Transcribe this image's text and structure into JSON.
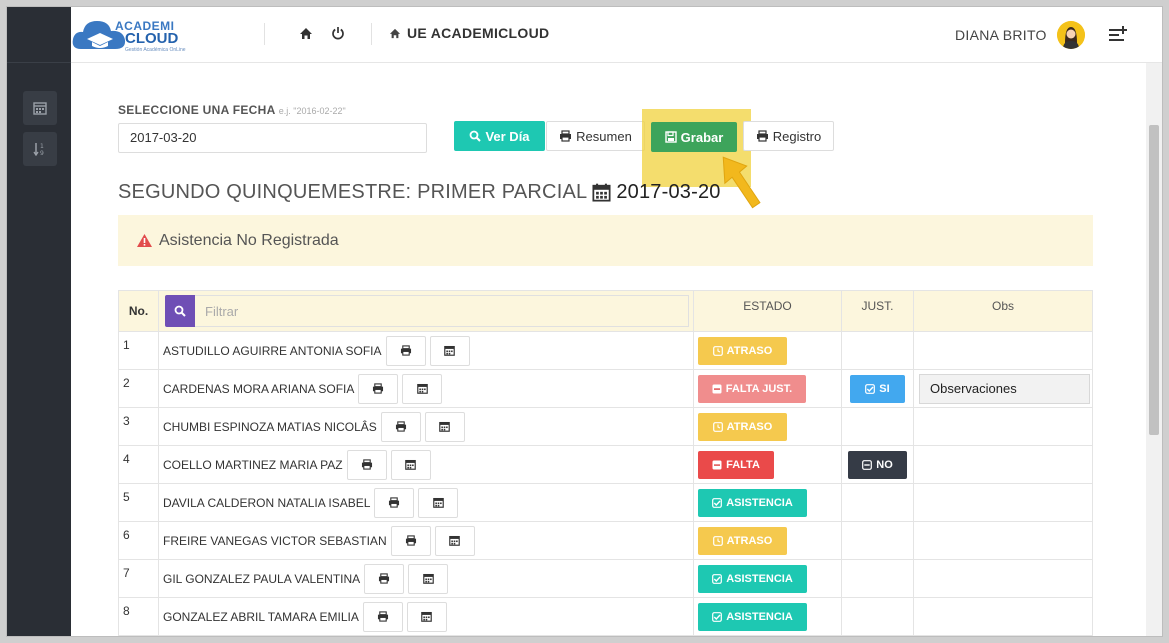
{
  "header": {
    "logo_line1": "ACADEMI",
    "logo_line2": "CLOUD",
    "logo_tagline": "Gestión Académica OnLine",
    "school_name": "UE ACADEMICLOUD",
    "user_name": "DIANA BRITO"
  },
  "date_selector": {
    "label": "SELECCIONE UNA FECHA",
    "hint": "e.j. \"2016-02-22\"",
    "value": "2017-03-20"
  },
  "toolbar": {
    "ver_dia": "Ver Día",
    "resumen": "Resumen",
    "grabar": "Grabar",
    "registro": "Registro"
  },
  "period": {
    "title": "SEGUNDO QUINQUEMESTRE: PRIMER PARCIAL",
    "date": "2017-03-20"
  },
  "alert": {
    "text": "Asistencia No Registrada"
  },
  "table": {
    "headers": {
      "no": "No.",
      "filter_placeholder": "Filtrar",
      "estado": "ESTADO",
      "just": "JUST.",
      "obs": "Obs"
    },
    "rows": [
      {
        "num": "1",
        "name": "ASTUDILLO AGUIRRE ANTONIA SOFIA",
        "estado": "ATRASO",
        "estado_type": "atraso",
        "just": "",
        "obs": ""
      },
      {
        "num": "2",
        "name": "CARDENAS MORA ARIANA SOFIA",
        "estado": "FALTA JUST.",
        "estado_type": "fjust",
        "just": "SI",
        "obs": "Observaciones"
      },
      {
        "num": "3",
        "name": "CHUMBI ESPINOZA MATIAS NICOLÂS",
        "estado": "ATRASO",
        "estado_type": "atraso",
        "just": "",
        "obs": ""
      },
      {
        "num": "4",
        "name": "COELLO MARTINEZ MARIA PAZ",
        "estado": "FALTA",
        "estado_type": "falta",
        "just": "NO",
        "obs": ""
      },
      {
        "num": "5",
        "name": "DAVILA CALDERON NATALIA ISABEL",
        "estado": "ASISTENCIA",
        "estado_type": "asist",
        "just": "",
        "obs": ""
      },
      {
        "num": "6",
        "name": "FREIRE VANEGAS VICTOR SEBASTIAN",
        "estado": "ATRASO",
        "estado_type": "atraso",
        "just": "",
        "obs": ""
      },
      {
        "num": "7",
        "name": "GIL GONZALEZ PAULA VALENTINA",
        "estado": "ASISTENCIA",
        "estado_type": "asist",
        "just": "",
        "obs": ""
      },
      {
        "num": "8",
        "name": "GONZALEZ ABRIL TAMARA EMILIA",
        "estado": "ASISTENCIA",
        "estado_type": "asist",
        "just": "",
        "obs": ""
      }
    ]
  },
  "colors": {
    "teal": "#1ec8b2",
    "green": "#3da45b",
    "yellow": "#f5c94e",
    "red": "#ea4a4a",
    "pink": "#f08d8d",
    "blue": "#42a8ef",
    "dark": "#353b46",
    "purple": "#6f4fb5"
  }
}
